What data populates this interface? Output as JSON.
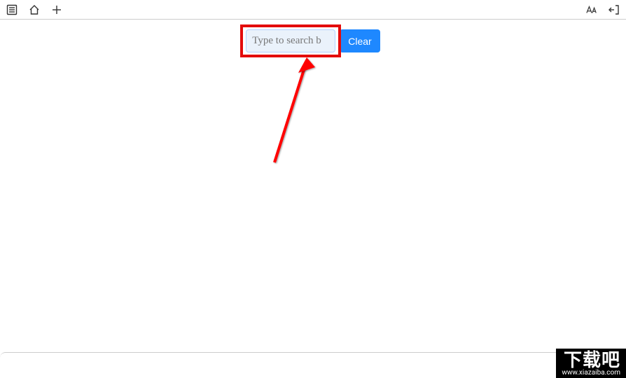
{
  "toolbar": {
    "icons": {
      "list": "list-icon",
      "home": "home-icon",
      "add": "plus-icon",
      "font": "font-size-icon",
      "exit": "exit-icon"
    }
  },
  "search": {
    "placeholder": "Type to search b",
    "value": "",
    "clear_label": "Clear"
  },
  "watermark": {
    "title": "下载吧",
    "url": "www.xiazaiba.com"
  },
  "annotation": {
    "highlight_color": "#e30b0b",
    "arrow_color": "#ff0000"
  }
}
